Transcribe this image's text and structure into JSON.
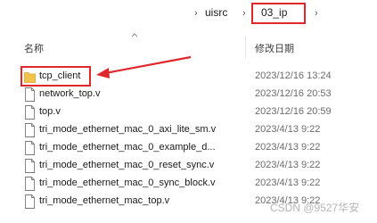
{
  "breadcrumb": {
    "items": [
      "uisrc",
      "03_ip"
    ]
  },
  "columns": {
    "name": "名称",
    "modified": "修改日期"
  },
  "files": [
    {
      "name": "tcp_client",
      "date": "2023/12/16 13:24",
      "type": "folder"
    },
    {
      "name": "network_top.v",
      "date": "2023/12/16 20:53",
      "type": "file"
    },
    {
      "name": "top.v",
      "date": "2023/12/16 20:59",
      "type": "file"
    },
    {
      "name": "tri_mode_ethernet_mac_0_axi_lite_sm.v",
      "date": "2023/4/13 9:22",
      "type": "file"
    },
    {
      "name": "tri_mode_ethernet_mac_0_example_d...",
      "date": "2023/4/13 9:22",
      "type": "file"
    },
    {
      "name": "tri_mode_ethernet_mac_0_reset_sync.v",
      "date": "2023/4/13 9:22",
      "type": "file"
    },
    {
      "name": "tri_mode_ethernet_mac_0_sync_block.v",
      "date": "2023/4/13 9:22",
      "type": "file"
    },
    {
      "name": "tri_mode_ethernet_mac_top.v",
      "date": "2023/4/13 9:22",
      "type": "file"
    }
  ],
  "watermark": "CSDN @9527华安",
  "colors": {
    "highlight": "#e0272c",
    "folder": "#f2c24a",
    "date_text": "#6b6b6b"
  }
}
